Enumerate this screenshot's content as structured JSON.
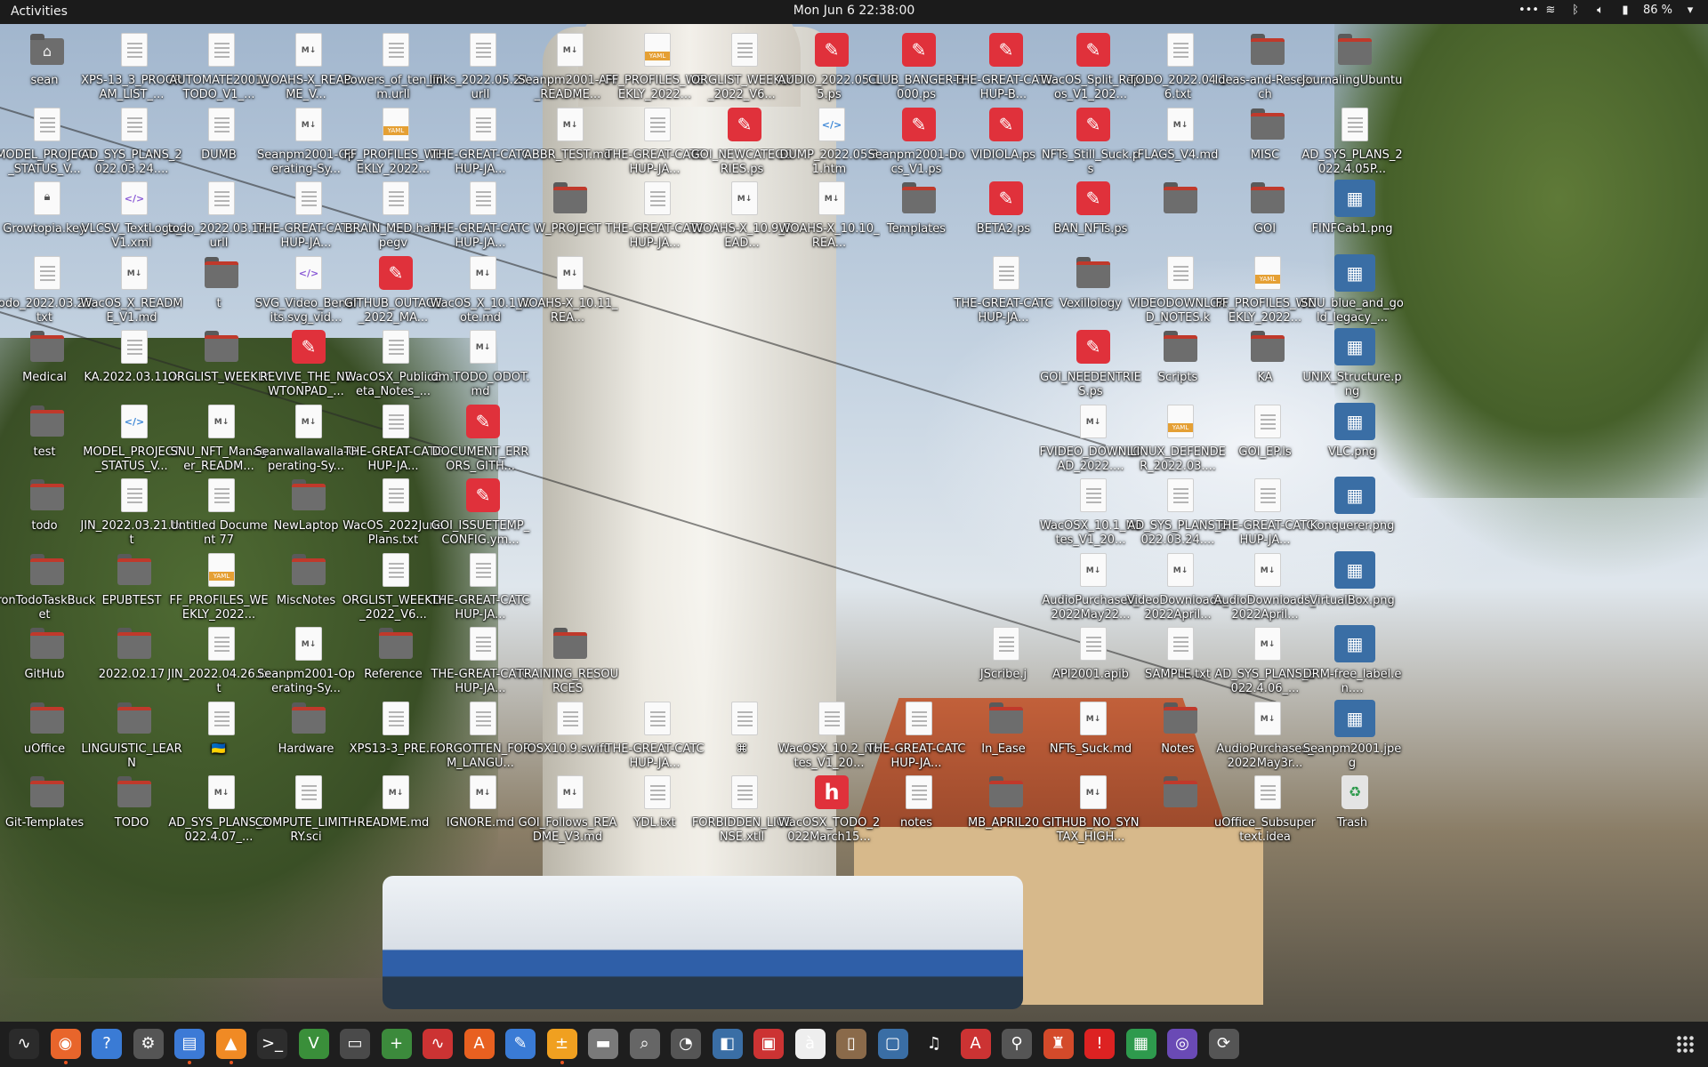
{
  "topbar": {
    "activities": "Activities",
    "clock": "Mon Jun 6  22:38:00",
    "battery": "86 %"
  },
  "desktop": {
    "icons": [
      {
        "label": "sean",
        "type": "home"
      },
      {
        "label": "XPS-13_3_PROGRAM_LIST_...",
        "type": "doc"
      },
      {
        "label": "AUTOMATE2001_TODO_V1_...",
        "type": "doc"
      },
      {
        "label": "WOAHS-X_README_V...",
        "type": "md"
      },
      {
        "label": "Powers_of_ten_film.urll",
        "type": "doc"
      },
      {
        "label": "links_2022.05.24.urll",
        "type": "doc"
      },
      {
        "label": "Seanpm2001-API_README...",
        "type": "md"
      },
      {
        "label": "FF_PROFILES_WEEKLY_2022...",
        "type": "yaml"
      },
      {
        "label": "ORGLIST_WEEKLY_2022_V6...",
        "type": "doc"
      },
      {
        "label": "AUDIO_2022.05.15.ps",
        "type": "ps"
      },
      {
        "label": "CLUB_BANGER-3000.ps",
        "type": "ps"
      },
      {
        "label": "THE-GREAT-CATCHUP-B...",
        "type": "ps"
      },
      {
        "label": "WacOS_Split_Repos_V1_202...",
        "type": "ps"
      },
      {
        "label": "TODO_2022.04.16.txt",
        "type": "doc"
      },
      {
        "label": "Ideas-and-Research",
        "type": "folder"
      },
      {
        "label": "JournalingUbuntu",
        "type": "folder"
      },
      {
        "label": "MODEL_PROJECT_STATUS_V...",
        "type": "doc"
      },
      {
        "label": "AD_SYS_PLANS_2022.03.24....",
        "type": "doc"
      },
      {
        "label": "DUMB",
        "type": "doc"
      },
      {
        "label": "Seanpm2001-Operating-Sy...",
        "type": "md"
      },
      {
        "label": "FF_PROFILES_WEEKLY_2022...",
        "type": "yaml"
      },
      {
        "label": "THE-GREAT-CATCHUP-JA...",
        "type": "doc"
      },
      {
        "label": "ABBR_TEST.md",
        "type": "md"
      },
      {
        "label": "THE-GREAT-CATCHUP-JA...",
        "type": "doc"
      },
      {
        "label": "GOI_NEWCATEGORIES.ps",
        "type": "ps"
      },
      {
        "label": "DUMP_2022.05.31.htm",
        "type": "html"
      },
      {
        "label": "Seanpm2001-Docs_V1.ps",
        "type": "ps"
      },
      {
        "label": "VIDIOLA.ps",
        "type": "ps"
      },
      {
        "label": "NFTs_Still_Suck.ps",
        "type": "ps"
      },
      {
        "label": "FLAGS_V4.md",
        "type": "md"
      },
      {
        "label": "MISC",
        "type": "folder"
      },
      {
        "label": "AD_SYS_PLANS_2022.4.05P...",
        "type": "doc"
      },
      {
        "label": "Growtopia.key",
        "type": "key"
      },
      {
        "label": "VLCSV_TextLogo_V1.xml",
        "type": "xml"
      },
      {
        "label": "todo_2022.03.14.urll",
        "type": "doc"
      },
      {
        "label": "THE-GREAT-CATCHUP-JA...",
        "type": "doc"
      },
      {
        "label": "BRAIN_MED.hampegv",
        "type": "doc"
      },
      {
        "label": "THE-GREAT-CATCHUP-JA...",
        "type": "doc"
      },
      {
        "label": "W_PROJECT",
        "type": "folder"
      },
      {
        "label": "THE-GREAT-CATCHUP-JA...",
        "type": "doc"
      },
      {
        "label": "WOAHS-X_10.9_READ...",
        "type": "md"
      },
      {
        "label": "WOAHS-X_10.10_REA...",
        "type": "md"
      },
      {
        "label": "Templates",
        "type": "folder"
      },
      {
        "label": "BETA2.ps",
        "type": "ps"
      },
      {
        "label": "BAN_NFTs.ps",
        "type": "ps"
      },
      {
        "label": "",
        "type": "folder"
      },
      {
        "label": "GOI",
        "type": "folder"
      },
      {
        "label": "FINFCab1.png",
        "type": "img"
      },
      {
        "label": "todo_2022.03.25.txt",
        "type": "doc"
      },
      {
        "label": "WacOS_X_README_V1.md",
        "type": "md"
      },
      {
        "label": "t",
        "type": "folder"
      },
      {
        "label": "SVG_Video_Benefits.svg_vid...",
        "type": "xml"
      },
      {
        "label": "GITHUB_OUTAGE_2022_MA...",
        "type": "ps"
      },
      {
        "label": "WacOS_X_10.1_Note.md",
        "type": "md"
      },
      {
        "label": "WOAHS-X_10.11_REA...",
        "type": "md"
      },
      {
        "label": "THE-GREAT-CATCHUP-JA...",
        "type": "doc"
      },
      {
        "label": "Vexillology",
        "type": "folder"
      },
      {
        "label": "VIDEODOWNLOAD_NOTES.k",
        "type": "doc"
      },
      {
        "label": "FF_PROFILES_WEEKLY_2022...",
        "type": "yaml"
      },
      {
        "label": "SNU_blue_and_gold_legacy_...",
        "type": "img"
      },
      {
        "label": "Medical",
        "type": "folder"
      },
      {
        "label": "KA.2022.03.11.k",
        "type": "doc"
      },
      {
        "label": "ORGLIST_WEEKLY",
        "type": "folder"
      },
      {
        "label": "REVIVE_THE_NEWTONPAD_...",
        "type": "ps"
      },
      {
        "label": "WacOSX_PublicBeta_Notes_...",
        "type": "doc"
      },
      {
        "label": "dm.TODO_ODOT.md",
        "type": "md"
      },
      {
        "label": "GOI_NEEDENTRIES.ps",
        "type": "ps"
      },
      {
        "label": "Scripts",
        "type": "folder"
      },
      {
        "label": "KA",
        "type": "folder"
      },
      {
        "label": "UNIX_Structure.png",
        "type": "img"
      },
      {
        "label": "test",
        "type": "folder"
      },
      {
        "label": "MODEL_PROJECT_STATUS_V...",
        "type": "html"
      },
      {
        "label": "SNU_NFT_Manager_READM...",
        "type": "md"
      },
      {
        "label": "Seanwallawalla-Operating-Sy...",
        "type": "md"
      },
      {
        "label": "THE-GREAT-CATCHUP-JA...",
        "type": "doc"
      },
      {
        "label": "DOCUMENT_ERRORS_GITH...",
        "type": "ps"
      },
      {
        "label": "FVIDEO_DOWNLOAD_2022....",
        "type": "md"
      },
      {
        "label": "LINUX_DEFENDER_2022.03....",
        "type": "yaml"
      },
      {
        "label": "GOI_EP.ls",
        "type": "doc"
      },
      {
        "label": "VLC.png",
        "type": "img"
      },
      {
        "label": "todo",
        "type": "folder"
      },
      {
        "label": "JIN_2022.03.21.txt",
        "type": "doc"
      },
      {
        "label": "Untitled Document 77",
        "type": "doc"
      },
      {
        "label": "NewLaptop",
        "type": "folder"
      },
      {
        "label": "WacOS_2022JunePlans.txt",
        "type": "doc"
      },
      {
        "label": "GOI_ISSUETEMP_CONFIG.ym...",
        "type": "ps"
      },
      {
        "label": "WacOSX_10.1_Notes_V1_20...",
        "type": "doc"
      },
      {
        "label": "AD_SYS_PLANS_2022.03.24....",
        "type": "doc"
      },
      {
        "label": "THE-GREAT-CATCHUP-JA...",
        "type": "doc"
      },
      {
        "label": "Konquerer.png",
        "type": "img"
      },
      {
        "label": "IronTodoTaskBucket",
        "type": "folder"
      },
      {
        "label": "EPUBTEST",
        "type": "folder"
      },
      {
        "label": "FF_PROFILES_WEEKLY_2022...",
        "type": "yaml"
      },
      {
        "label": "MiscNotes",
        "type": "folder"
      },
      {
        "label": "ORGLIST_WEEKLY_2022_V6...",
        "type": "doc"
      },
      {
        "label": "THE-GREAT-CATCHUP-JA...",
        "type": "doc"
      },
      {
        "label": "AudioPurchases_2022May22...",
        "type": "md"
      },
      {
        "label": "VideoDownloads_2022April...",
        "type": "md"
      },
      {
        "label": "AudioDownloads_2022April...",
        "type": "md"
      },
      {
        "label": "VirtualBox.png",
        "type": "img"
      },
      {
        "label": "GitHub",
        "type": "folder"
      },
      {
        "label": "2022.02.17",
        "type": "folder"
      },
      {
        "label": "JIN_2022.04.26.txt",
        "type": "doc"
      },
      {
        "label": "Seanpm2001-Operating-Sy...",
        "type": "md"
      },
      {
        "label": "Reference",
        "type": "folder"
      },
      {
        "label": "THE-GREAT-CATCHUP-JA...",
        "type": "doc"
      },
      {
        "label": "TRAINING_RESOURCES",
        "type": "folder"
      },
      {
        "label": "JScribe.j",
        "type": "doc"
      },
      {
        "label": "API2001.apib",
        "type": "doc"
      },
      {
        "label": "SAMPLE.txt",
        "type": "doc"
      },
      {
        "label": "AD_SYS_PLANS_2022.4.06_...",
        "type": "md"
      },
      {
        "label": "DRM-free_label.en....",
        "type": "img"
      },
      {
        "label": "uOffice",
        "type": "folder"
      },
      {
        "label": "LINGUISTIC_LEARN",
        "type": "folder"
      },
      {
        "label": "🇺🇦",
        "type": "doc"
      },
      {
        "label": "Hardware",
        "type": "folder"
      },
      {
        "label": "XPS13-3_PRE...",
        "type": "doc"
      },
      {
        "label": "FORGOTTEN_FORM_LANGU...",
        "type": "doc"
      },
      {
        "label": "OSX10.9.swift",
        "type": "doc"
      },
      {
        "label": "THE-GREAT-CATCHUP-JA...",
        "type": "doc"
      },
      {
        "label": "⌘",
        "type": "doc"
      },
      {
        "label": "WacOSX_10.2_Notes_V1_20...",
        "type": "doc"
      },
      {
        "label": "THE-GREAT-CATCHUP-JA...",
        "type": "doc"
      },
      {
        "label": "In_Ease",
        "type": "folder"
      },
      {
        "label": "NFTs_Suck.md",
        "type": "md"
      },
      {
        "label": "Notes",
        "type": "folder"
      },
      {
        "label": "AudioPurchases_2022May3r...",
        "type": "md"
      },
      {
        "label": "Seanpm2001.jpeg",
        "type": "img"
      },
      {
        "label": "Git-Templates",
        "type": "folder"
      },
      {
        "label": "TODO",
        "type": "folder"
      },
      {
        "label": "AD_SYS_PLANS_2022.4.07_...",
        "type": "md"
      },
      {
        "label": "COMPUTE_LIMITHRY.sci",
        "type": "doc"
      },
      {
        "label": "README.md",
        "type": "md"
      },
      {
        "label": "IGNORE.md",
        "type": "md"
      },
      {
        "label": "GOI_Follows_README_V3.md",
        "type": "md"
      },
      {
        "label": "YDL.txt",
        "type": "doc"
      },
      {
        "label": "FORBIDDEN_LICENSE.xtll",
        "type": "doc"
      },
      {
        "label": "WacOSX_TODO_2022March15...",
        "type": "heb"
      },
      {
        "label": "notes",
        "type": "doc"
      },
      {
        "label": "MB_APRIL20",
        "type": "folder"
      },
      {
        "label": "GITHUB_NO_SYNTAX_HIGH...",
        "type": "md"
      },
      {
        "label": "",
        "type": "folder"
      },
      {
        "label": "uOffice_Subsupertext.idea",
        "type": "doc"
      },
      {
        "label": "Trash",
        "type": "trash"
      }
    ]
  },
  "dock": {
    "apps": [
      {
        "name": "system-monitor-icon",
        "glyph": "∿",
        "color": "#2b2b2b"
      },
      {
        "name": "firefox-icon",
        "glyph": "◉",
        "color": "#e8652b"
      },
      {
        "name": "help-icon",
        "glyph": "?",
        "color": "#3a7bd5"
      },
      {
        "name": "settings-icon",
        "glyph": "⚙",
        "color": "#555555"
      },
      {
        "name": "text-editor-icon",
        "glyph": "▤",
        "color": "#3c7ad6"
      },
      {
        "name": "vlc-icon",
        "glyph": "▲",
        "color": "#f08a24"
      },
      {
        "name": "terminal-icon",
        "glyph": ">_",
        "color": "#2d2d2d"
      },
      {
        "name": "vim-icon",
        "glyph": "V",
        "color": "#3a8f3a"
      },
      {
        "name": "remote-desktop-icon",
        "glyph": "▭",
        "color": "#4a4a4a"
      },
      {
        "name": "plus-app-icon",
        "glyph": "+",
        "color": "#3c8a3c"
      },
      {
        "name": "graph-app-icon",
        "glyph": "∿",
        "color": "#cc3333"
      },
      {
        "name": "software-center-icon",
        "glyph": "A",
        "color": "#e86020"
      },
      {
        "name": "notes-app-icon",
        "glyph": "✎",
        "color": "#3a7bd5"
      },
      {
        "name": "calculator-icon",
        "glyph": "±",
        "color": "#f0a020"
      },
      {
        "name": "files-icon",
        "glyph": "▬",
        "color": "#7a7a7a"
      },
      {
        "name": "image-viewer-icon",
        "glyph": "⌕",
        "color": "#666666"
      },
      {
        "name": "disk-usage-icon",
        "glyph": "◔",
        "color": "#555555"
      },
      {
        "name": "dictionary-icon",
        "glyph": "◧",
        "color": "#3a6ea5"
      },
      {
        "name": "document-viewer-icon",
        "glyph": "▣",
        "color": "#cc3333"
      },
      {
        "name": "character-map-icon",
        "glyph": "à",
        "color": "#eeeeee"
      },
      {
        "name": "archive-manager-icon",
        "glyph": "▯",
        "color": "#8a6a4a"
      },
      {
        "name": "screenshot-icon",
        "glyph": "▢",
        "color": "#3a6ea5"
      },
      {
        "name": "music-icon",
        "glyph": "♫",
        "color": "#1e1e1e"
      },
      {
        "name": "font-viewer-icon",
        "glyph": "A",
        "color": "#cc3333"
      },
      {
        "name": "search-tool-icon",
        "glyph": "⚲",
        "color": "#555555"
      },
      {
        "name": "game-icon",
        "glyph": "♜",
        "color": "#d44a2a"
      },
      {
        "name": "alert-app-icon",
        "glyph": "!",
        "color": "#dd2222"
      },
      {
        "name": "spreadsheet-icon",
        "glyph": "▦",
        "color": "#2e9a4d"
      },
      {
        "name": "camera-app-icon",
        "glyph": "◎",
        "color": "#6a4ab5"
      },
      {
        "name": "update-icon",
        "glyph": "⟳",
        "color": "#555555"
      }
    ]
  }
}
